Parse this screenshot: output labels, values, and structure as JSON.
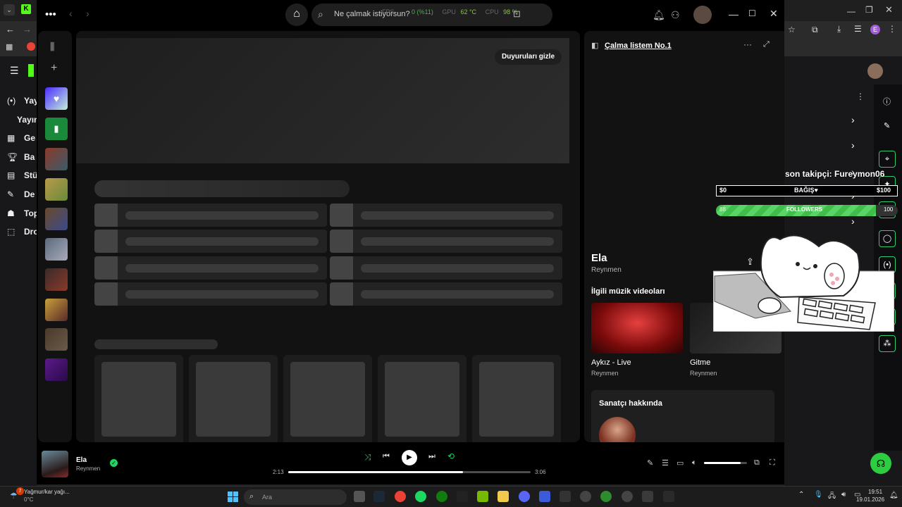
{
  "spotify": {
    "search_placeholder": "Ne çalmak istiyorsun?",
    "perf_overlay": {
      "fps_label": "FPS",
      "value_paren": "0 (%11)",
      "gpu_label": "GPU",
      "gpu_value": "62 °C",
      "cpu_label": "CPU",
      "cpu_value": "98 %"
    },
    "announcement_button": "Duyuruları gizle",
    "right_panel": {
      "playlist_title": "Çalma listem No.1",
      "track_title": "Ela",
      "artist": "Reynmen",
      "related_videos_heading": "İlgili müzik videoları",
      "videos": [
        {
          "title": "Aykız - Live",
          "artist": "Reynmen"
        },
        {
          "title": "Gitme",
          "artist": "Reynmen"
        }
      ],
      "about_artist_heading": "Sanatçı hakkında"
    },
    "player": {
      "track_title": "Ela",
      "artist": "Reynmen",
      "elapsed": "2:13",
      "duration": "3:06",
      "progress": 0.72,
      "volume": 0.85
    }
  },
  "overlay": {
    "last_follower": "son takipçi: Fureymon06",
    "donation_min": "$0",
    "donation_label": "BAĞIŞ♥",
    "donation_max": "$100",
    "followers_current": "88",
    "followers_label": "FOLLOWERS",
    "followers_goal": "100",
    "followers_fraction": 0.88
  },
  "twitch_sidebar": {
    "items": [
      {
        "icon": "broadcast-icon",
        "label": "Yay"
      },
      {
        "icon": "",
        "label": "Yayın"
      },
      {
        "icon": "grid-icon",
        "label": "Ge"
      },
      {
        "icon": "trophy-icon",
        "label": "Ba"
      },
      {
        "icon": "studio-icon",
        "label": "Stü"
      },
      {
        "icon": "wrench-icon",
        "label": "De"
      },
      {
        "icon": "community-icon",
        "label": "Top"
      },
      {
        "icon": "drops-icon",
        "label": "Dro"
      }
    ]
  },
  "taskbar": {
    "weather_text": "Yağmur/kar yağı...",
    "temperature": "0°C",
    "weather_badge": "7",
    "search_placeholder": "Ara",
    "time": "19:51",
    "date": "19.01.2026"
  },
  "colors": {
    "spotify_green": "#1ed760",
    "overlay_green": "#3fbf4a",
    "panel_bg": "#121212"
  }
}
